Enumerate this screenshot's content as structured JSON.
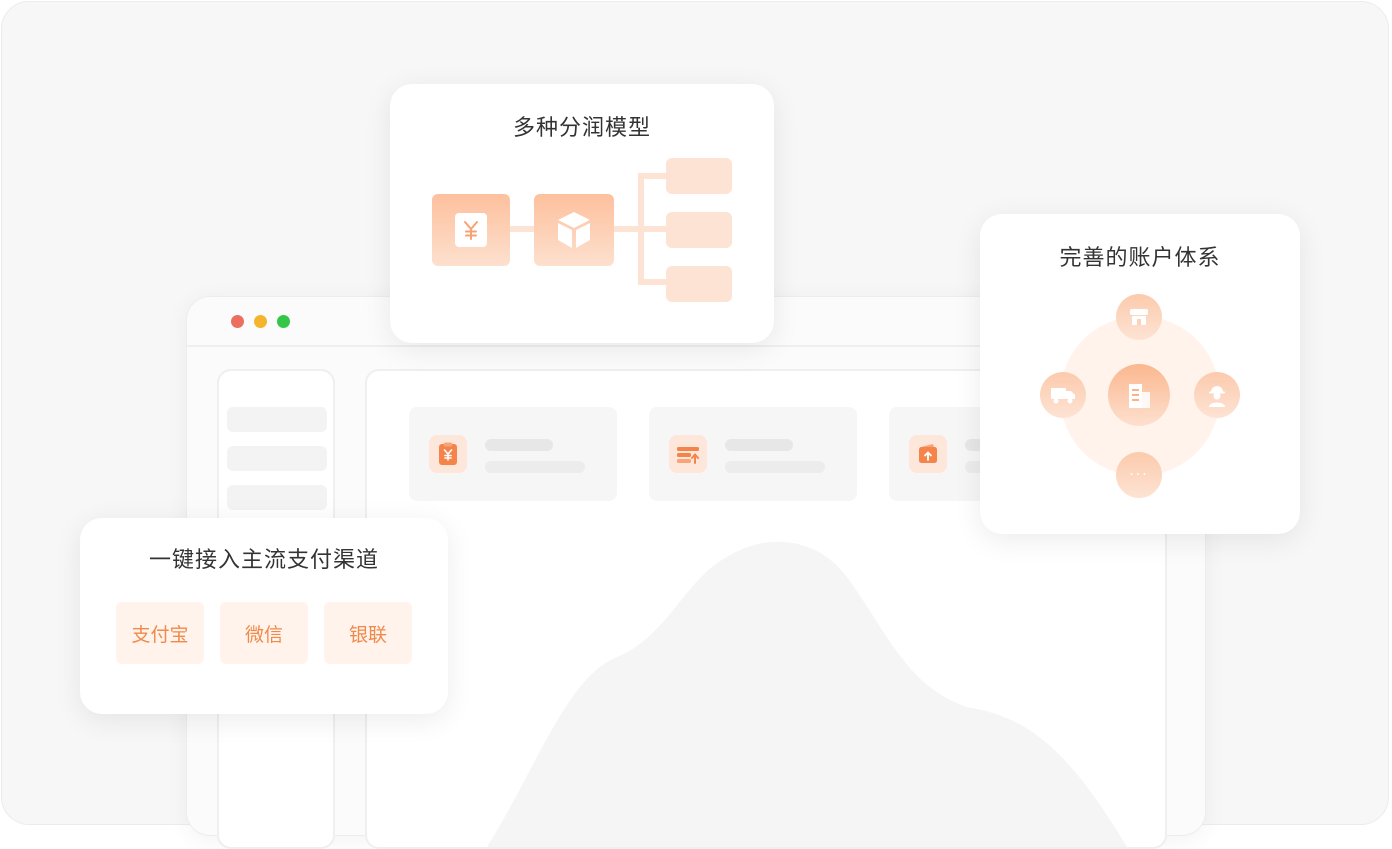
{
  "browser": {
    "window_controls": [
      "close",
      "minimize",
      "maximize"
    ],
    "stat_icons": [
      "receipt-yuan-icon",
      "layers-upload-icon",
      "wallet-upload-icon"
    ]
  },
  "split_card": {
    "title": "多种分润模型",
    "icons": [
      "yuan-icon",
      "package-icon"
    ]
  },
  "account_card": {
    "title": "完善的账户体系",
    "nodes": {
      "center": "building-icon",
      "top": "store-icon",
      "left": "truck-icon",
      "right": "worker-icon",
      "bottom": "···"
    }
  },
  "channel_card": {
    "title": "一键接入主流支付渠道",
    "channels": [
      "支付宝",
      "微信",
      "银联"
    ]
  },
  "colors": {
    "accent": "#f08a4b",
    "accent_light": "#fde3d4",
    "accent_pale": "#fff3ec"
  }
}
